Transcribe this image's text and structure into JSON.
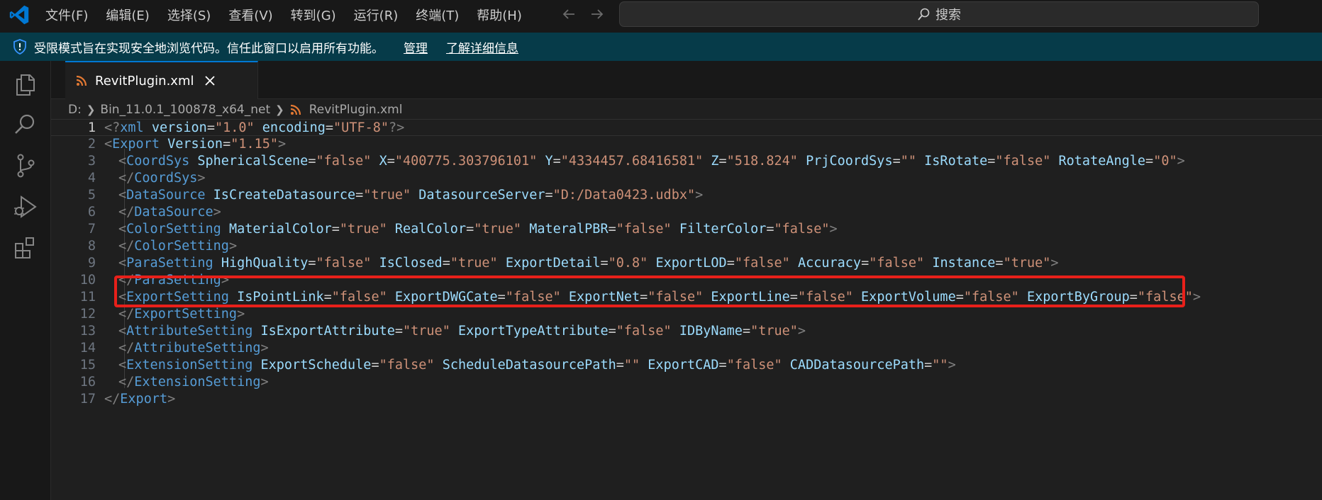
{
  "menu": [
    "文件(F)",
    "编辑(E)",
    "选择(S)",
    "查看(V)",
    "转到(G)",
    "运行(R)",
    "终端(T)",
    "帮助(H)"
  ],
  "search": {
    "label": "搜索"
  },
  "banner": {
    "message": "受限模式旨在实现安全地浏览代码。信任此窗口以启用所有功能。",
    "manage_link": "管理",
    "learn_more_link": "了解详细信息"
  },
  "tab": {
    "label": "RevitPlugin.xml"
  },
  "breadcrumb": {
    "drive": "D:",
    "folder": "Bin_11.0.1_100878_x64_net",
    "file": "RevitPlugin.xml"
  },
  "editor": {
    "current_line": 1,
    "highlighted_line": 9,
    "lines": [
      {
        "n": "1",
        "indent": 0,
        "tokens": [
          [
            "t",
            "<"
          ],
          [
            "t",
            "?"
          ],
          [
            "tag",
            "xml"
          ],
          [
            "eq",
            " "
          ],
          [
            "attr",
            "version"
          ],
          [
            "eq",
            "="
          ],
          [
            "str",
            "\"1.0\""
          ],
          [
            "eq",
            " "
          ],
          [
            "attr",
            "encoding"
          ],
          [
            "eq",
            "="
          ],
          [
            "str",
            "\"UTF-8\""
          ],
          [
            "t",
            "?>"
          ]
        ]
      },
      {
        "n": "2",
        "indent": 0,
        "tokens": [
          [
            "t",
            "<"
          ],
          [
            "tag",
            "Export"
          ],
          [
            "eq",
            " "
          ],
          [
            "attr",
            "Version"
          ],
          [
            "eq",
            "="
          ],
          [
            "str",
            "\"1.15\""
          ],
          [
            "t",
            ">"
          ]
        ]
      },
      {
        "n": "3",
        "indent": 1,
        "tokens": [
          [
            "t",
            "<"
          ],
          [
            "tag",
            "CoordSys"
          ],
          [
            "eq",
            " "
          ],
          [
            "attr",
            "SphericalScene"
          ],
          [
            "eq",
            "="
          ],
          [
            "str",
            "\"false\""
          ],
          [
            "eq",
            " "
          ],
          [
            "attr",
            "X"
          ],
          [
            "eq",
            "="
          ],
          [
            "str",
            "\"400775.303796101\""
          ],
          [
            "eq",
            " "
          ],
          [
            "attr",
            "Y"
          ],
          [
            "eq",
            "="
          ],
          [
            "str",
            "\"4334457.68416581\""
          ],
          [
            "eq",
            " "
          ],
          [
            "attr",
            "Z"
          ],
          [
            "eq",
            "="
          ],
          [
            "str",
            "\"518.824\""
          ],
          [
            "eq",
            " "
          ],
          [
            "attr",
            "PrjCoordSys"
          ],
          [
            "eq",
            "="
          ],
          [
            "str",
            "\"\""
          ],
          [
            "eq",
            " "
          ],
          [
            "attr",
            "IsRotate"
          ],
          [
            "eq",
            "="
          ],
          [
            "str",
            "\"false\""
          ],
          [
            "eq",
            " "
          ],
          [
            "attr",
            "RotateAngle"
          ],
          [
            "eq",
            "="
          ],
          [
            "str",
            "\"0\""
          ],
          [
            "t",
            ">"
          ]
        ]
      },
      {
        "n": "4",
        "indent": 1,
        "tokens": [
          [
            "t",
            "</"
          ],
          [
            "tag",
            "CoordSys"
          ],
          [
            "t",
            ">"
          ]
        ]
      },
      {
        "n": "5",
        "indent": 1,
        "tokens": [
          [
            "t",
            "<"
          ],
          [
            "tag",
            "DataSource"
          ],
          [
            "eq",
            " "
          ],
          [
            "attr",
            "IsCreateDatasource"
          ],
          [
            "eq",
            "="
          ],
          [
            "str",
            "\"true\""
          ],
          [
            "eq",
            " "
          ],
          [
            "attr",
            "DatasourceServer"
          ],
          [
            "eq",
            "="
          ],
          [
            "str",
            "\"D:/Data0423.udbx\""
          ],
          [
            "t",
            ">"
          ]
        ]
      },
      {
        "n": "6",
        "indent": 1,
        "tokens": [
          [
            "t",
            "</"
          ],
          [
            "tag",
            "DataSource"
          ],
          [
            "t",
            ">"
          ]
        ]
      },
      {
        "n": "7",
        "indent": 1,
        "tokens": [
          [
            "t",
            "<"
          ],
          [
            "tag",
            "ColorSetting"
          ],
          [
            "eq",
            " "
          ],
          [
            "attr",
            "MaterialColor"
          ],
          [
            "eq",
            "="
          ],
          [
            "str",
            "\"true\""
          ],
          [
            "eq",
            " "
          ],
          [
            "attr",
            "RealColor"
          ],
          [
            "eq",
            "="
          ],
          [
            "str",
            "\"true\""
          ],
          [
            "eq",
            " "
          ],
          [
            "attr",
            "MateralPBR"
          ],
          [
            "eq",
            "="
          ],
          [
            "str",
            "\"false\""
          ],
          [
            "eq",
            " "
          ],
          [
            "attr",
            "FilterColor"
          ],
          [
            "eq",
            "="
          ],
          [
            "str",
            "\"false\""
          ],
          [
            "t",
            ">"
          ]
        ]
      },
      {
        "n": "8",
        "indent": 1,
        "tokens": [
          [
            "t",
            "</"
          ],
          [
            "tag",
            "ColorSetting"
          ],
          [
            "t",
            ">"
          ]
        ]
      },
      {
        "n": "9",
        "indent": 1,
        "tokens": [
          [
            "t",
            "<"
          ],
          [
            "tag",
            "ParaSetting"
          ],
          [
            "eq",
            " "
          ],
          [
            "attr",
            "HighQuality"
          ],
          [
            "eq",
            "="
          ],
          [
            "str",
            "\"false\""
          ],
          [
            "eq",
            " "
          ],
          [
            "attr",
            "IsClosed"
          ],
          [
            "eq",
            "="
          ],
          [
            "str",
            "\"true\""
          ],
          [
            "eq",
            " "
          ],
          [
            "attr",
            "ExportDetail"
          ],
          [
            "eq",
            "="
          ],
          [
            "str",
            "\"0.8\""
          ],
          [
            "eq",
            " "
          ],
          [
            "attr",
            "ExportLOD"
          ],
          [
            "eq",
            "="
          ],
          [
            "str",
            "\"false\""
          ],
          [
            "eq",
            " "
          ],
          [
            "attr",
            "Accuracy"
          ],
          [
            "eq",
            "="
          ],
          [
            "str",
            "\"false\""
          ],
          [
            "eq",
            " "
          ],
          [
            "attr",
            "Instance"
          ],
          [
            "eq",
            "="
          ],
          [
            "str",
            "\"true\""
          ],
          [
            "t",
            ">"
          ]
        ]
      },
      {
        "n": "10",
        "indent": 1,
        "tokens": [
          [
            "t",
            "</"
          ],
          [
            "tag",
            "ParaSetting"
          ],
          [
            "t",
            ">"
          ]
        ]
      },
      {
        "n": "11",
        "indent": 1,
        "tokens": [
          [
            "t",
            "<"
          ],
          [
            "tag",
            "ExportSetting"
          ],
          [
            "eq",
            " "
          ],
          [
            "attr",
            "IsPointLink"
          ],
          [
            "eq",
            "="
          ],
          [
            "str",
            "\"false\""
          ],
          [
            "eq",
            " "
          ],
          [
            "attr",
            "ExportDWGCate"
          ],
          [
            "eq",
            "="
          ],
          [
            "str",
            "\"false\""
          ],
          [
            "eq",
            " "
          ],
          [
            "attr",
            "ExportNet"
          ],
          [
            "eq",
            "="
          ],
          [
            "str",
            "\"false\""
          ],
          [
            "eq",
            " "
          ],
          [
            "attr",
            "ExportLine"
          ],
          [
            "eq",
            "="
          ],
          [
            "str",
            "\"false\""
          ],
          [
            "eq",
            " "
          ],
          [
            "attr",
            "ExportVolume"
          ],
          [
            "eq",
            "="
          ],
          [
            "str",
            "\"false\""
          ],
          [
            "eq",
            " "
          ],
          [
            "attr",
            "ExportByGroup"
          ],
          [
            "eq",
            "="
          ],
          [
            "str",
            "\"false\""
          ],
          [
            "t",
            ">"
          ]
        ]
      },
      {
        "n": "12",
        "indent": 1,
        "tokens": [
          [
            "t",
            "</"
          ],
          [
            "tag",
            "ExportSetting"
          ],
          [
            "t",
            ">"
          ]
        ]
      },
      {
        "n": "13",
        "indent": 1,
        "tokens": [
          [
            "t",
            "<"
          ],
          [
            "tag",
            "AttributeSetting"
          ],
          [
            "eq",
            " "
          ],
          [
            "attr",
            "IsExportAttribute"
          ],
          [
            "eq",
            "="
          ],
          [
            "str",
            "\"true\""
          ],
          [
            "eq",
            " "
          ],
          [
            "attr",
            "ExportTypeAttribute"
          ],
          [
            "eq",
            "="
          ],
          [
            "str",
            "\"false\""
          ],
          [
            "eq",
            " "
          ],
          [
            "attr",
            "IDByName"
          ],
          [
            "eq",
            "="
          ],
          [
            "str",
            "\"true\""
          ],
          [
            "t",
            ">"
          ]
        ]
      },
      {
        "n": "14",
        "indent": 1,
        "tokens": [
          [
            "t",
            "</"
          ],
          [
            "tag",
            "AttributeSetting"
          ],
          [
            "t",
            ">"
          ]
        ]
      },
      {
        "n": "15",
        "indent": 1,
        "tokens": [
          [
            "t",
            "<"
          ],
          [
            "tag",
            "ExtensionSetting"
          ],
          [
            "eq",
            " "
          ],
          [
            "attr",
            "ExportSchedule"
          ],
          [
            "eq",
            "="
          ],
          [
            "str",
            "\"false\""
          ],
          [
            "eq",
            " "
          ],
          [
            "attr",
            "ScheduleDatasourcePath"
          ],
          [
            "eq",
            "="
          ],
          [
            "str",
            "\"\""
          ],
          [
            "eq",
            " "
          ],
          [
            "attr",
            "ExportCAD"
          ],
          [
            "eq",
            "="
          ],
          [
            "str",
            "\"false\""
          ],
          [
            "eq",
            " "
          ],
          [
            "attr",
            "CADDatasourcePath"
          ],
          [
            "eq",
            "="
          ],
          [
            "str",
            "\"\""
          ],
          [
            "t",
            ">"
          ]
        ]
      },
      {
        "n": "16",
        "indent": 1,
        "tokens": [
          [
            "t",
            "</"
          ],
          [
            "tag",
            "ExtensionSetting"
          ],
          [
            "t",
            ">"
          ]
        ]
      },
      {
        "n": "17",
        "indent": 0,
        "tokens": [
          [
            "t",
            "</"
          ],
          [
            "tag",
            "Export"
          ],
          [
            "t",
            ">"
          ]
        ]
      }
    ]
  },
  "colors": {
    "accent": "#0078d4",
    "banner_bg": "#063b49",
    "highlight_box": "#e8201a",
    "tag": "#569cd6",
    "attribute": "#9cdcfe",
    "string": "#ce9178"
  }
}
